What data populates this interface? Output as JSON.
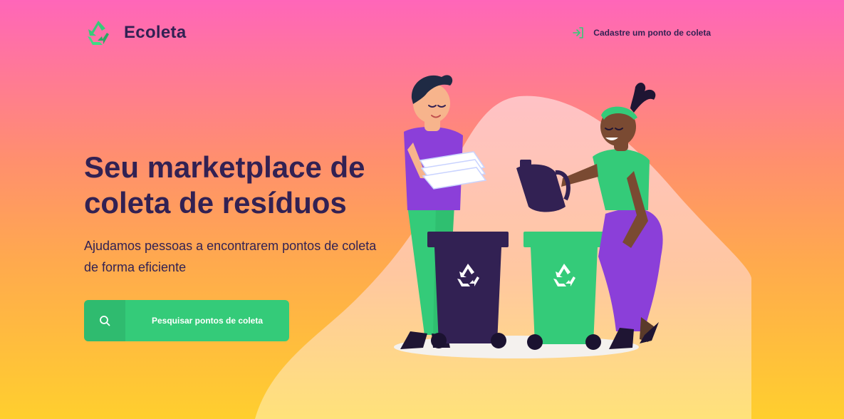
{
  "header": {
    "logo_text": "Ecoleta",
    "signup_link": "Cadastre um ponto de coleta"
  },
  "hero": {
    "title_line1": "Seu marketplace de",
    "title_line2": "coleta de resíduos",
    "description_line1": "Ajudamos pessoas a encontrarem pontos de coleta",
    "description_line2": "de forma eficiente",
    "search_button": "Pesquisar pontos de coleta"
  },
  "icons": {
    "logo": "recycle-icon",
    "signup": "login-arrow-icon",
    "search": "search-icon"
  },
  "colors": {
    "primary": "#34cb79",
    "title": "#322153",
    "gradient_top": "#ff66b9",
    "gradient_bottom": "#ffcf2e"
  }
}
